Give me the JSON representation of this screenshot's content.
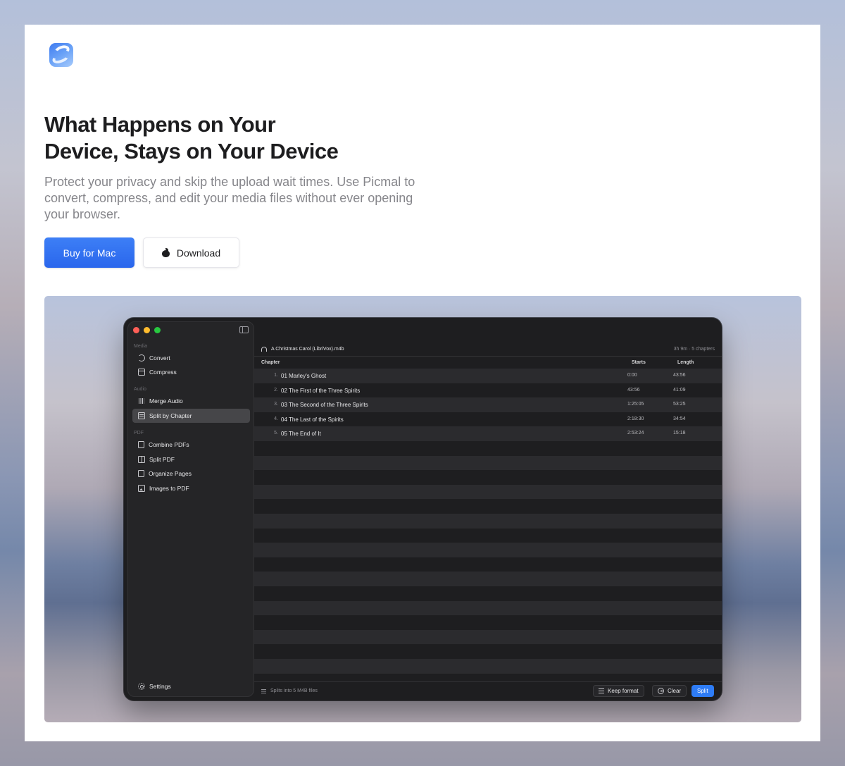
{
  "hero": {
    "title_line1": "What Happens on Your",
    "title_line2": "Device, Stays on Your Device",
    "subtitle": "Protect your privacy and skip the upload wait times. Use Picmal to convert, compress, and edit your media files without ever opening your browser.",
    "buy_label": "Buy for Mac",
    "download_label": "Download",
    "accent_color": "#2a66ec"
  },
  "app": {
    "sidebar": {
      "sections": {
        "media": "Media",
        "audio": "Audio",
        "pdf": "PDF"
      },
      "items": {
        "convert": "Convert",
        "compress": "Compress",
        "merge_audio": "Merge Audio",
        "split_by_chapter": "Split by Chapter",
        "combine_pdfs": "Combine PDFs",
        "split_pdf": "Split PDF",
        "organize_pages": "Organize Pages",
        "images_to_pdf": "Images to PDF",
        "settings": "Settings"
      },
      "active_item": "split_by_chapter"
    },
    "file": {
      "name": "A Christmas Carol (LibriVox).m4b",
      "meta": "3h 9m · 5 chapters"
    },
    "table": {
      "headers": {
        "chapter": "Chapter",
        "starts": "Starts",
        "length": "Length"
      },
      "rows": [
        {
          "num": "1.",
          "title": "01 Marley's Ghost",
          "starts": "0:00",
          "length": "43:56"
        },
        {
          "num": "2.",
          "title": "02 The First of the Three Spirits",
          "starts": "43:56",
          "length": "41:09"
        },
        {
          "num": "3.",
          "title": "03 The Second of the Three Spirits",
          "starts": "1:25:05",
          "length": "53:25"
        },
        {
          "num": "4.",
          "title": "04 The Last of the Spirits",
          "starts": "2:18:30",
          "length": "34:54"
        },
        {
          "num": "5.",
          "title": "05 The End of It",
          "starts": "2:53:24",
          "length": "15:18"
        }
      ]
    },
    "footer": {
      "note": "Splits into 5 M4B files",
      "keep_format": "Keep format",
      "clear": "Clear",
      "split": "Split"
    }
  }
}
